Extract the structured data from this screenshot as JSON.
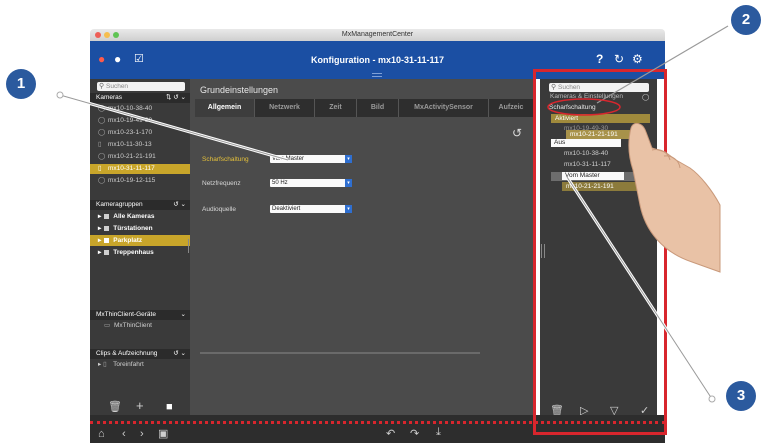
{
  "window": {
    "title": "MxManagementCenter"
  },
  "toolbar": {
    "title": "Konfiguration - mx10-31-11-117",
    "icons": [
      "alarm-icon",
      "chat-icon",
      "checkbox-icon",
      "help-icon",
      "refresh-icon",
      "gear-icon"
    ],
    "help": "?",
    "refresh": "↻",
    "gear": "⚙"
  },
  "left": {
    "search_placeholder": "Suchen",
    "cameras_header": "Kameras",
    "cameras": [
      {
        "label": "mx10-10-38-40",
        "selected": false
      },
      {
        "label": "mx10-19-49-30",
        "selected": false
      },
      {
        "label": "mx10-23-1-170",
        "selected": false
      },
      {
        "label": "mx10-11-30-13",
        "selected": false
      },
      {
        "label": "mx10-21-21-191",
        "selected": false
      },
      {
        "label": "mx10-31-11-117",
        "selected": true
      },
      {
        "label": "mx10-19-12-115",
        "selected": false
      }
    ],
    "groups_header": "Kameragruppen",
    "groups": [
      {
        "label": "Alle Kameras",
        "selected": false
      },
      {
        "label": "Türstationen",
        "selected": false
      },
      {
        "label": "Parkplatz",
        "selected": true
      },
      {
        "label": "Treppenhaus",
        "selected": false
      }
    ],
    "thin_header": "MxThinClient-Geräte",
    "thin_item": "MxThinClient",
    "clips_header": "Clips & Aufzeichnung",
    "clips_item": "Toreinfahrt"
  },
  "main": {
    "section_title": "Grundeinstellungen",
    "tabs": [
      "Allgemein",
      "Netzwerk",
      "Zeit",
      "Bild",
      "MxActivitySensor",
      "Aufzeic"
    ],
    "active_tab": "Allgemein",
    "fields": [
      {
        "label": "Scharfschaltung",
        "value": "Vom Master",
        "highlight": true
      },
      {
        "label": "Netzfrequenz",
        "value": "50 Hz",
        "highlight": false
      },
      {
        "label": "Audioquelle",
        "value": "Deaktiviert",
        "highlight": false
      }
    ]
  },
  "right": {
    "search_placeholder": "Suchen",
    "header": "Kameras & Einstellungen",
    "scharfschaltung": "Scharfschaltung",
    "aktiviert": "Aktiviert",
    "drag_cam": "mx10-21-21-191",
    "ghost_cam": "mx10-19-49-30",
    "aus": "Aus",
    "aus_cams": [
      "mx10-10-38-40",
      "mx10-31-11-117"
    ],
    "vom_master": "Vom Master",
    "master_cam": "mx10-21-21-191"
  },
  "badges": [
    "1",
    "2",
    "3"
  ],
  "colors": {
    "accent_blue": "#1b4fa3",
    "selection_gold": "#c8a52a",
    "highlight_red": "#d8262d",
    "badge_blue": "#2b5a9e"
  }
}
